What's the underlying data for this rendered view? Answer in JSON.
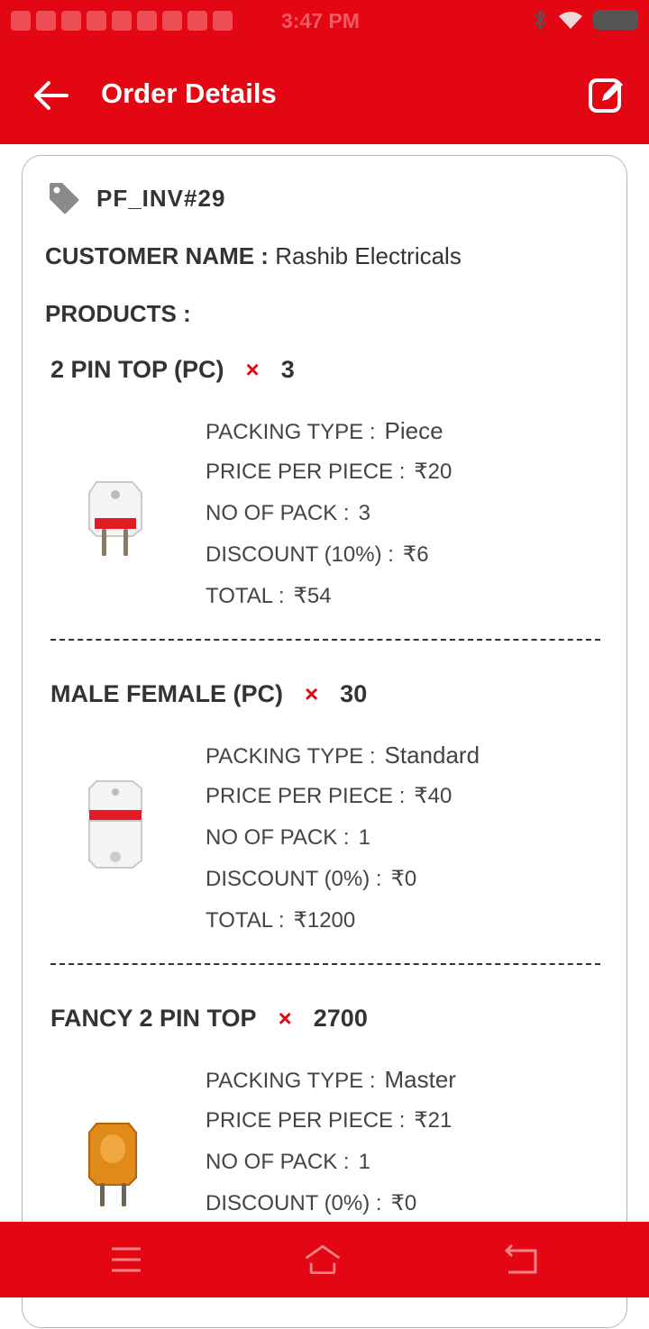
{
  "status_bar": {
    "time": "3:47 PM"
  },
  "app_bar": {
    "title": "Order Details"
  },
  "order": {
    "invoice_no": "PF_INV#29",
    "customer_label": "CUSTOMER NAME :",
    "customer_name": "Rashib Electricals",
    "products_label": "PRODUCTS :"
  },
  "labels": {
    "packing_type": "PACKING TYPE :",
    "price_per_piece": "PRICE PER PIECE :",
    "no_of_pack": "NO OF PACK :",
    "total": "TOTAL :",
    "multiply": "×"
  },
  "products": [
    {
      "name": "2 PIN TOP (PC)",
      "quantity": "3",
      "packing_type": "Piece",
      "price_per_piece": "₹20",
      "no_of_pack": "3",
      "discount_label": "DISCOUNT (10%) :",
      "discount": "₹6",
      "total": "₹54"
    },
    {
      "name": "MALE FEMALE (PC)",
      "quantity": "30",
      "packing_type": "Standard",
      "price_per_piece": "₹40",
      "no_of_pack": "1",
      "discount_label": "DISCOUNT (0%) :",
      "discount": "₹0",
      "total": "₹1200"
    },
    {
      "name": "FANCY 2 PIN TOP",
      "quantity": "2700",
      "packing_type": "Master",
      "price_per_piece": "₹21",
      "no_of_pack": "1",
      "discount_label": "DISCOUNT (0%) :",
      "discount": "₹0",
      "total": ""
    }
  ],
  "colors": {
    "primary": "#e30613",
    "text": "#333333"
  },
  "icons": {
    "back": "arrow-left-icon",
    "edit": "edit-icon",
    "tag": "tag-icon",
    "nav_menu": "menu-icon",
    "nav_home": "home-icon",
    "nav_back": "back-icon"
  }
}
